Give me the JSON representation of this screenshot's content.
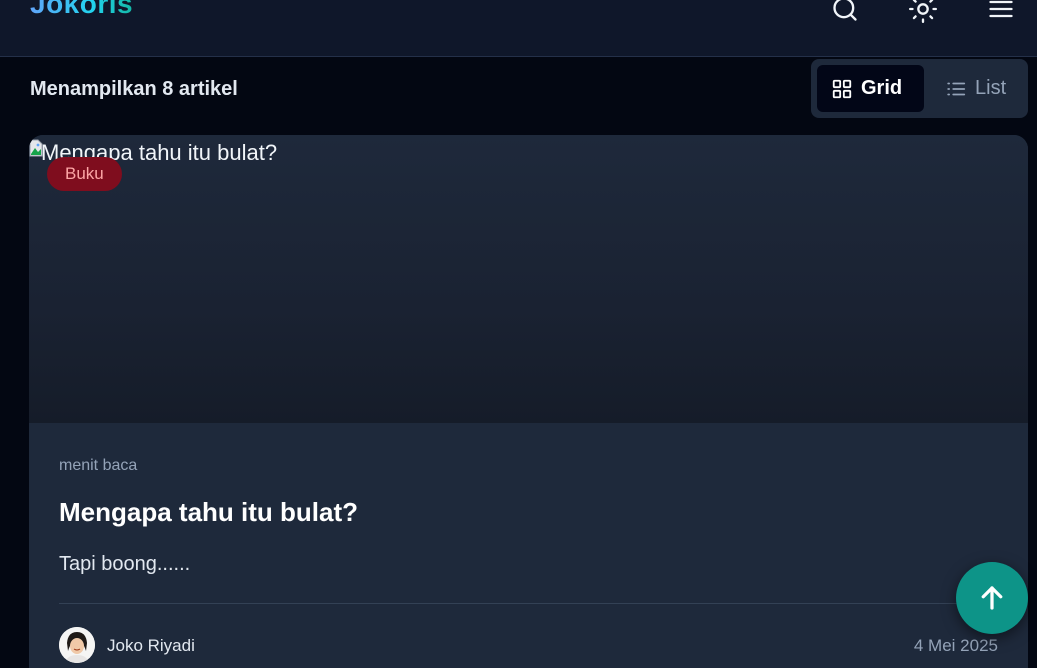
{
  "header": {
    "brand": "Jokoris",
    "icons": [
      "search-icon",
      "sun-icon",
      "menu-icon"
    ]
  },
  "toolbar": {
    "count_label": "Menampilkan 8 artikel",
    "view_grid_label": "Grid",
    "view_list_label": "List",
    "active_view": "Grid"
  },
  "article": {
    "image_alt": "Mengapa tahu itu bulat?",
    "category": "Buku",
    "reading_time": "menit baca",
    "title": "Mengapa tahu itu bulat?",
    "excerpt": "Tapi boong......",
    "author": "Joko Riyadi",
    "date": "4 Mei 2025"
  },
  "colors": {
    "accent": "#0d9488",
    "badge_bg": "#7f0d1e",
    "badge_text": "#fca5a5",
    "card_bg": "#1e293b",
    "page_bg": "#030712"
  }
}
